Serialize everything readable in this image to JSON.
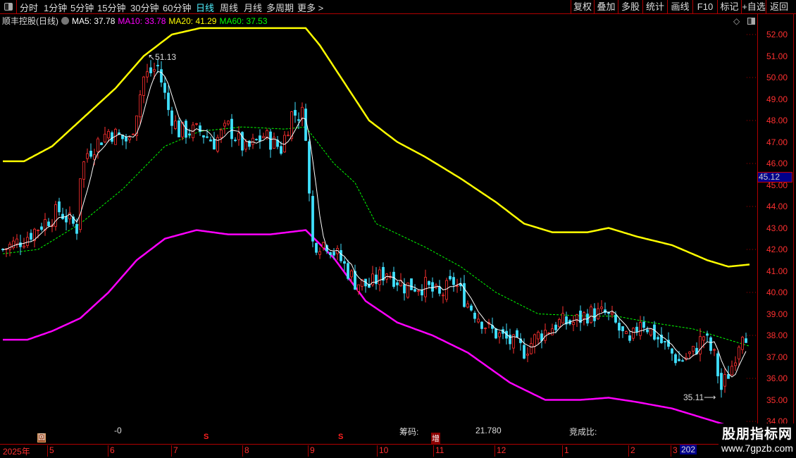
{
  "topbar": {
    "periods": [
      "分时",
      "1分钟",
      "5分钟",
      "15分钟",
      "30分钟",
      "60分钟",
      "日线",
      "周线",
      "月线",
      "多周期",
      "更多 >"
    ],
    "active": "日线",
    "right_buttons": [
      "复权",
      "叠加",
      "多股",
      "统计",
      "画线",
      "F10",
      "标记",
      "+自选",
      "返回"
    ]
  },
  "title": {
    "stock": "顺丰控股(日线)",
    "ma5": "MA5: 37.78",
    "ma10": "MA10: 33.78",
    "ma20": "MA20: 41.29",
    "ma60": "MA60: 37.53"
  },
  "colors": {
    "ma5": "#ffffff",
    "ma10": "#ff00ff",
    "ma20": "#ffff00",
    "ma60": "#00ff00",
    "up": "#ff3030",
    "down": "#40e0ff",
    "axis": "#ff3030",
    "grid": "#b00000"
  },
  "price_axis": {
    "labels": [
      "52.00",
      "51.00",
      "50.00",
      "49.00",
      "48.00",
      "47.00",
      "46.00",
      "45.00",
      "44.00",
      "43.00",
      "42.00",
      "41.00",
      "40.00",
      "39.00",
      "38.00",
      "37.00",
      "36.00",
      "35.00",
      "34.00"
    ],
    "current": "45.12"
  },
  "annotations": {
    "high": "51.13",
    "low": "35.11"
  },
  "indicator": {
    "v1": "-0",
    "chip_label": "筹码:",
    "chip_value": "21.780",
    "ratio_label": "竞成比:",
    "marks": [
      "回",
      "S",
      "S",
      "增"
    ]
  },
  "time_axis": {
    "labels": [
      "2025年",
      "5",
      "6",
      "7",
      "8",
      "9",
      "10",
      "11",
      "12",
      "1",
      "2",
      "3"
    ],
    "current": "202"
  },
  "watermark": {
    "line1": "股朋指标网",
    "line2": "www.7gpzb.com"
  },
  "chart_data": {
    "type": "candlestick",
    "count": 212,
    "ylim": [
      34,
      52.5
    ],
    "price_path": [
      [
        0,
        42.0
      ],
      [
        6,
        42.5
      ],
      [
        12,
        43.3
      ],
      [
        16,
        43.8
      ],
      [
        21,
        43.0
      ],
      [
        22,
        45.5
      ],
      [
        24,
        46.5
      ],
      [
        30,
        47.5
      ],
      [
        36,
        47.0
      ],
      [
        40,
        50
      ],
      [
        44,
        50.5
      ],
      [
        47,
        48.5
      ],
      [
        50,
        47.5
      ],
      [
        56,
        47.5
      ],
      [
        60,
        47
      ],
      [
        64,
        47.7
      ],
      [
        69,
        46.6
      ],
      [
        74,
        47.3
      ],
      [
        79,
        46.7
      ],
      [
        82,
        48.3
      ],
      [
        85,
        48.3
      ],
      [
        86,
        47.5
      ],
      [
        87,
        44.5
      ],
      [
        88,
        42.3
      ],
      [
        92,
        42.3
      ],
      [
        96,
        41.5
      ],
      [
        100,
        40.5
      ],
      [
        104,
        40.3
      ],
      [
        109,
        41
      ],
      [
        114,
        40.3
      ],
      [
        120,
        40.3
      ],
      [
        124,
        39.8
      ],
      [
        128,
        40.5
      ],
      [
        132,
        39.5
      ],
      [
        138,
        38.3
      ],
      [
        143,
        37.8
      ],
      [
        148,
        37.3
      ],
      [
        152,
        38
      ],
      [
        158,
        38.6
      ],
      [
        162,
        38.6
      ],
      [
        166,
        39.0
      ],
      [
        171,
        39.0
      ],
      [
        174,
        38.5
      ],
      [
        178,
        37.5
      ],
      [
        181,
        38.8
      ],
      [
        184,
        38.2
      ],
      [
        188,
        37.5
      ],
      [
        192,
        36.8
      ],
      [
        196,
        37.2
      ],
      [
        199,
        38
      ],
      [
        202,
        37.0
      ],
      [
        204,
        35.5
      ],
      [
        207,
        36.6
      ],
      [
        210,
        38.3
      ],
      [
        211,
        38.1
      ]
    ],
    "upper_band": [
      [
        0,
        46.1
      ],
      [
        6,
        46.1
      ],
      [
        14,
        46.8
      ],
      [
        22,
        48.0
      ],
      [
        32,
        49.5
      ],
      [
        40,
        51
      ],
      [
        48,
        52
      ],
      [
        56,
        52.3
      ],
      [
        70,
        52.3
      ],
      [
        80,
        52.3
      ],
      [
        86,
        52.3
      ],
      [
        90,
        51.5
      ],
      [
        96,
        50
      ],
      [
        104,
        48
      ],
      [
        112,
        47
      ],
      [
        120,
        46.3
      ],
      [
        130,
        45.3
      ],
      [
        140,
        44.2
      ],
      [
        148,
        43.2
      ],
      [
        156,
        42.8
      ],
      [
        166,
        42.8
      ],
      [
        172,
        43.0
      ],
      [
        180,
        42.6
      ],
      [
        190,
        42.2
      ],
      [
        200,
        41.5
      ],
      [
        206,
        41.2
      ],
      [
        212,
        41.3
      ]
    ],
    "lower_band": [
      [
        0,
        37.8
      ],
      [
        7,
        37.8
      ],
      [
        14,
        38.2
      ],
      [
        22,
        38.8
      ],
      [
        30,
        40
      ],
      [
        38,
        41.5
      ],
      [
        46,
        42.5
      ],
      [
        55,
        42.9
      ],
      [
        64,
        42.7
      ],
      [
        76,
        42.7
      ],
      [
        86,
        42.9
      ],
      [
        94,
        41.6
      ],
      [
        103,
        39.6
      ],
      [
        112,
        38.6
      ],
      [
        122,
        38.0
      ],
      [
        132,
        37.2
      ],
      [
        144,
        35.8
      ],
      [
        154,
        35.0
      ],
      [
        164,
        35.0
      ],
      [
        172,
        35.1
      ],
      [
        180,
        34.9
      ],
      [
        190,
        34.6
      ],
      [
        200,
        34.1
      ],
      [
        206,
        33.8
      ]
    ],
    "ma60": [
      [
        0,
        41.8
      ],
      [
        10,
        42.0
      ],
      [
        22,
        43.2
      ],
      [
        34,
        44.8
      ],
      [
        46,
        46.8
      ],
      [
        56,
        47.5
      ],
      [
        68,
        47.7
      ],
      [
        80,
        47.6
      ],
      [
        86,
        47.7
      ],
      [
        94,
        46
      ],
      [
        100,
        45.1
      ],
      [
        106,
        43.2
      ],
      [
        120,
        42.1
      ],
      [
        130,
        41.2
      ],
      [
        140,
        40.0
      ],
      [
        152,
        39.0
      ],
      [
        166,
        38.9
      ],
      [
        174,
        38.9
      ],
      [
        184,
        38.6
      ],
      [
        196,
        38.3
      ],
      [
        204,
        37.9
      ],
      [
        212,
        37.5
      ]
    ]
  }
}
